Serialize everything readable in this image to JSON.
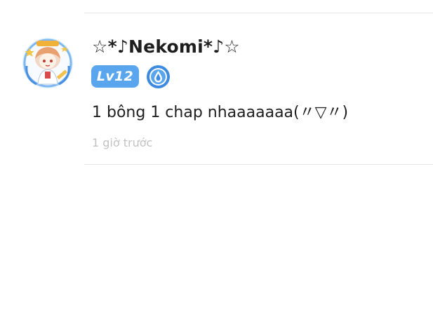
{
  "comment": {
    "username": "☆*♪Nekomi*♪☆",
    "level_badge": "Lv12",
    "rank_icon": "blue-drop-rank-icon",
    "text": "1 bông 1 chap nhaaaaaaa(〃▽〃)",
    "timestamp": "1 giờ trước",
    "avatar_icon": "anime-girl-avatar"
  },
  "colors": {
    "level_badge_bg": "#5aa6ee",
    "rank_badge": "#3d8be0",
    "divider": "#e6e6e6",
    "timestamp": "#c2c2c2"
  }
}
